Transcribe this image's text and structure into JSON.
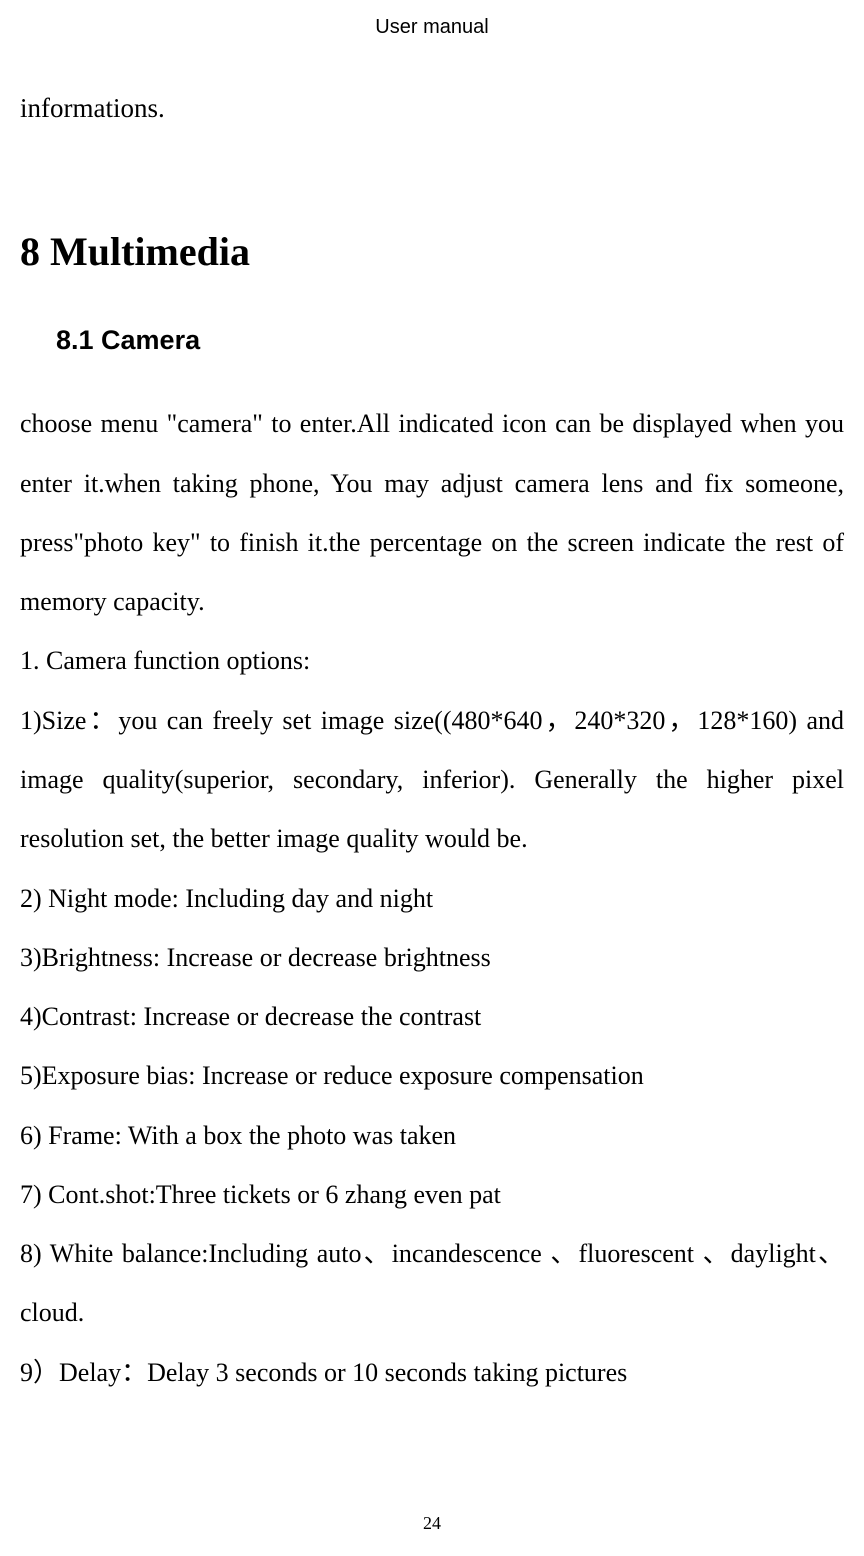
{
  "header": {
    "title": "User manual"
  },
  "intro": "informations.",
  "h1": "8 Multimedia",
  "h2": "8.1 Camera",
  "body": {
    "p1": "choose menu \"camera\" to enter.All indicated icon can be displayed when you enter it.when taking phone, You may adjust camera lens and fix someone, press\"photo key\" to finish it.the percentage on the screen indicate the rest of memory capacity.",
    "p2": "1. Camera function options:",
    "p3": "1)Size：you can freely set image size((480*640，240*320，128*160) and image quality(superior, secondary, inferior). Generally the higher pixel resolution set, the better image quality would be.",
    "p4": "2) Night mode:    Including day and night",
    "p5": "3)Brightness: Increase or decrease brightness",
    "p6": "4)Contrast: Increase or decrease the contrast",
    "p7": "5)Exposure bias: Increase or reduce exposure compensation",
    "p8": "6) Frame: With a box the photo was taken",
    "p9": "7) Cont.shot:Three tickets or 6 zhang even pat",
    "p10": "8) White balance:Including auto、incandescence 、fluorescent 、daylight、cloud.",
    "p11": "9）Delay：Delay 3 seconds or 10 seconds taking pictures"
  },
  "page_number": "24"
}
